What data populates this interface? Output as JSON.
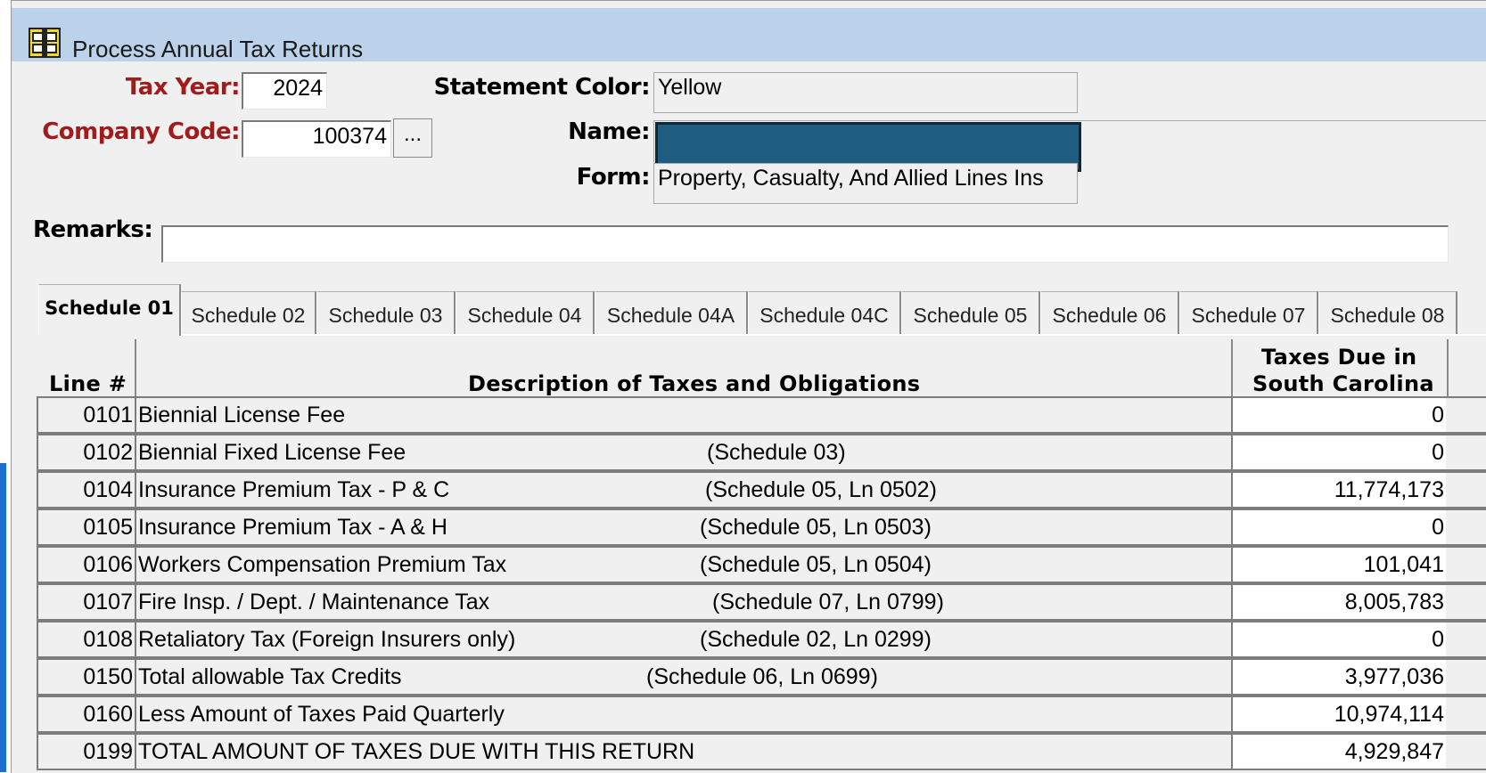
{
  "window": {
    "title": "Process Annual Tax Returns",
    "icon": "app-form-icon"
  },
  "header": {
    "tax_year_label": "Tax Year:",
    "tax_year_value": "2024",
    "company_code_label": "Company Code:",
    "company_code_value": "100374",
    "lookup_button_label": "...",
    "statement_color_label": "Statement Color:",
    "statement_color_value": "Yellow",
    "name_label": "Name:",
    "form_label": "Form:",
    "form_value": "Property, Casualty, And Allied Lines Ins",
    "remarks_label": "Remarks:",
    "remarks_value": ""
  },
  "tabs": [
    {
      "label": "Schedule 01",
      "active": true
    },
    {
      "label": "Schedule 02"
    },
    {
      "label": "Schedule 03"
    },
    {
      "label": "Schedule 04"
    },
    {
      "label": "Schedule 04A"
    },
    {
      "label": "Schedule 04C"
    },
    {
      "label": "Schedule 05"
    },
    {
      "label": "Schedule 06"
    },
    {
      "label": "Schedule 07"
    },
    {
      "label": "Schedule 08"
    }
  ],
  "table": {
    "headers": {
      "line": "Line #",
      "description": "Description of Taxes and Obligations",
      "amount_line1": "Taxes Due in",
      "amount_line2": "South Carolina"
    },
    "rows": [
      {
        "line": "0101",
        "desc": "Biennial License Fee",
        "ref": "",
        "amount": "0"
      },
      {
        "line": "0102",
        "desc": "Biennial Fixed License Fee",
        "ref": "(Schedule 03)",
        "amount": "0"
      },
      {
        "line": "0104",
        "desc": "Insurance Premium Tax - P & C",
        "ref": "(Schedule 05, Ln 0502)",
        "amount": "11,774,173"
      },
      {
        "line": "0105",
        "desc": "Insurance Premium Tax - A & H",
        "ref": "(Schedule 05, Ln 0503)",
        "amount": "0"
      },
      {
        "line": "0106",
        "desc": "Workers Compensation Premium Tax",
        "ref": "(Schedule 05, Ln 0504)",
        "amount": "101,041"
      },
      {
        "line": "0107",
        "desc": "Fire Insp. / Dept. / Maintenance Tax",
        "ref": "(Schedule 07, Ln 0799)",
        "amount": "8,005,783"
      },
      {
        "line": "0108",
        "desc": "Retaliatory Tax (Foreign Insurers only)",
        "ref": "(Schedule 02, Ln 0299)",
        "amount": "0"
      },
      {
        "line": "0150",
        "desc": "Total allowable Tax Credits",
        "ref": "(Schedule 06, Ln 0699)",
        "amount": "3,977,036"
      },
      {
        "line": "0160",
        "desc": "Less Amount of Taxes Paid Quarterly",
        "ref": "",
        "amount": "10,974,114"
      },
      {
        "line": "0199",
        "desc": "TOTAL AMOUNT OF TAXES DUE WITH THIS RETURN",
        "ref": "",
        "amount": "4,929,847"
      }
    ]
  }
}
